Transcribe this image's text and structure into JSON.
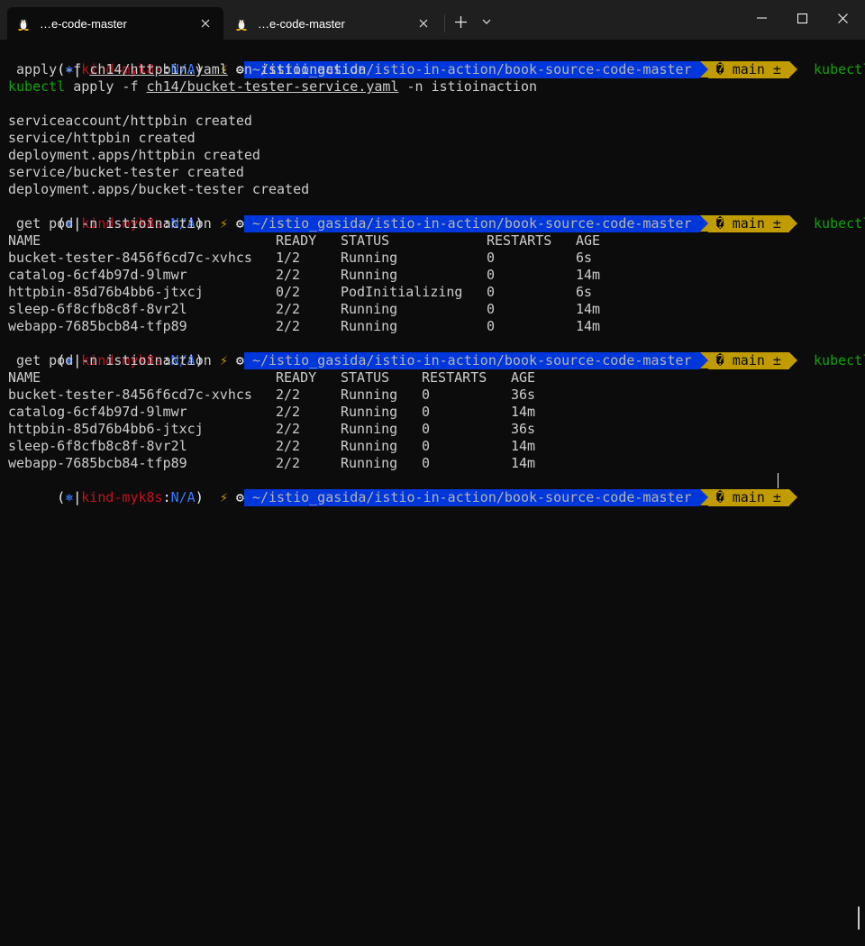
{
  "tabs": [
    {
      "title": "…e-code-master",
      "icon": "linux-penguin-icon",
      "active": true
    },
    {
      "title": "…e-code-master",
      "icon": "linux-penguin-icon",
      "active": false
    }
  ],
  "titlebar": {
    "new_tab_glyph": "+",
    "dropdown_glyph": "⌄",
    "minimize_glyph": "—",
    "maximize_glyph": "☐",
    "close_glyph": "✕"
  },
  "prompt": {
    "open_paren": "(",
    "k8s_icon": "⎈",
    "separator": "|",
    "context": "kind-myk8s",
    "colon": ":",
    "namespace": "N/A",
    "close_paren": ")",
    "bolt": "⚡",
    "gear": "⚙",
    "path": "~/istio_gasida/istio-in-action/book-source-code-master",
    "git_branch_icon": "�",
    "branch": "main",
    "dirty": "±"
  },
  "commands": {
    "first": {
      "word": "kubectl",
      "cont_line": " apply -f ",
      "file1": "ch14/httpbin.yaml",
      "rest1": " -n istioinaction",
      "line2_word": "kubectl",
      "line2_pre": " apply -f ",
      "file2": "ch14/bucket-tester-service.yaml",
      "rest2": " -n istioinaction"
    },
    "second": {
      "word": "kubectl",
      "cont_line": " get pod -n istioinaction"
    },
    "third": {
      "word": "kubectl",
      "cont_line": " get pod -n istioinaction"
    }
  },
  "apply_output": [
    "serviceaccount/httpbin created",
    "service/httpbin created",
    "deployment.apps/httpbin created",
    "service/bucket-tester created",
    "deployment.apps/bucket-tester created"
  ],
  "pods_table_1": {
    "headers": [
      "NAME",
      "READY",
      "STATUS",
      "RESTARTS",
      "AGE"
    ],
    "rows": [
      [
        "bucket-tester-8456f6cd7c-xvhcs",
        "1/2",
        "Running",
        "0",
        "6s"
      ],
      [
        "catalog-6cf4b97d-9lmwr",
        "2/2",
        "Running",
        "0",
        "14m"
      ],
      [
        "httpbin-85d76b4bb6-jtxcj",
        "0/2",
        "PodInitializing",
        "0",
        "6s"
      ],
      [
        "sleep-6f8cfb8c8f-8vr2l",
        "2/2",
        "Running",
        "0",
        "14m"
      ],
      [
        "webapp-7685bcb84-tfp89",
        "2/2",
        "Running",
        "0",
        "14m"
      ]
    ]
  },
  "pods_table_2": {
    "headers": [
      "NAME",
      "READY",
      "STATUS",
      "RESTARTS",
      "AGE"
    ],
    "rows": [
      [
        "bucket-tester-8456f6cd7c-xvhcs",
        "2/2",
        "Running",
        "0",
        "36s"
      ],
      [
        "catalog-6cf4b97d-9lmwr",
        "2/2",
        "Running",
        "0",
        "14m"
      ],
      [
        "httpbin-85d76b4bb6-jtxcj",
        "2/2",
        "Running",
        "0",
        "36s"
      ],
      [
        "sleep-6f8cfb8c8f-8vr2l",
        "2/2",
        "Running",
        "0",
        "14m"
      ],
      [
        "webapp-7685bcb84-tfp89",
        "2/2",
        "Running",
        "0",
        "14m"
      ]
    ]
  },
  "colors": {
    "background": "#0c0c0c",
    "titlebar": "#1f1f1f",
    "path_bg": "#0037da",
    "git_bg": "#c19c00",
    "context_red": "#c50f1f",
    "namespace_blue": "#3b78ff",
    "command_green": "#13a10e"
  }
}
